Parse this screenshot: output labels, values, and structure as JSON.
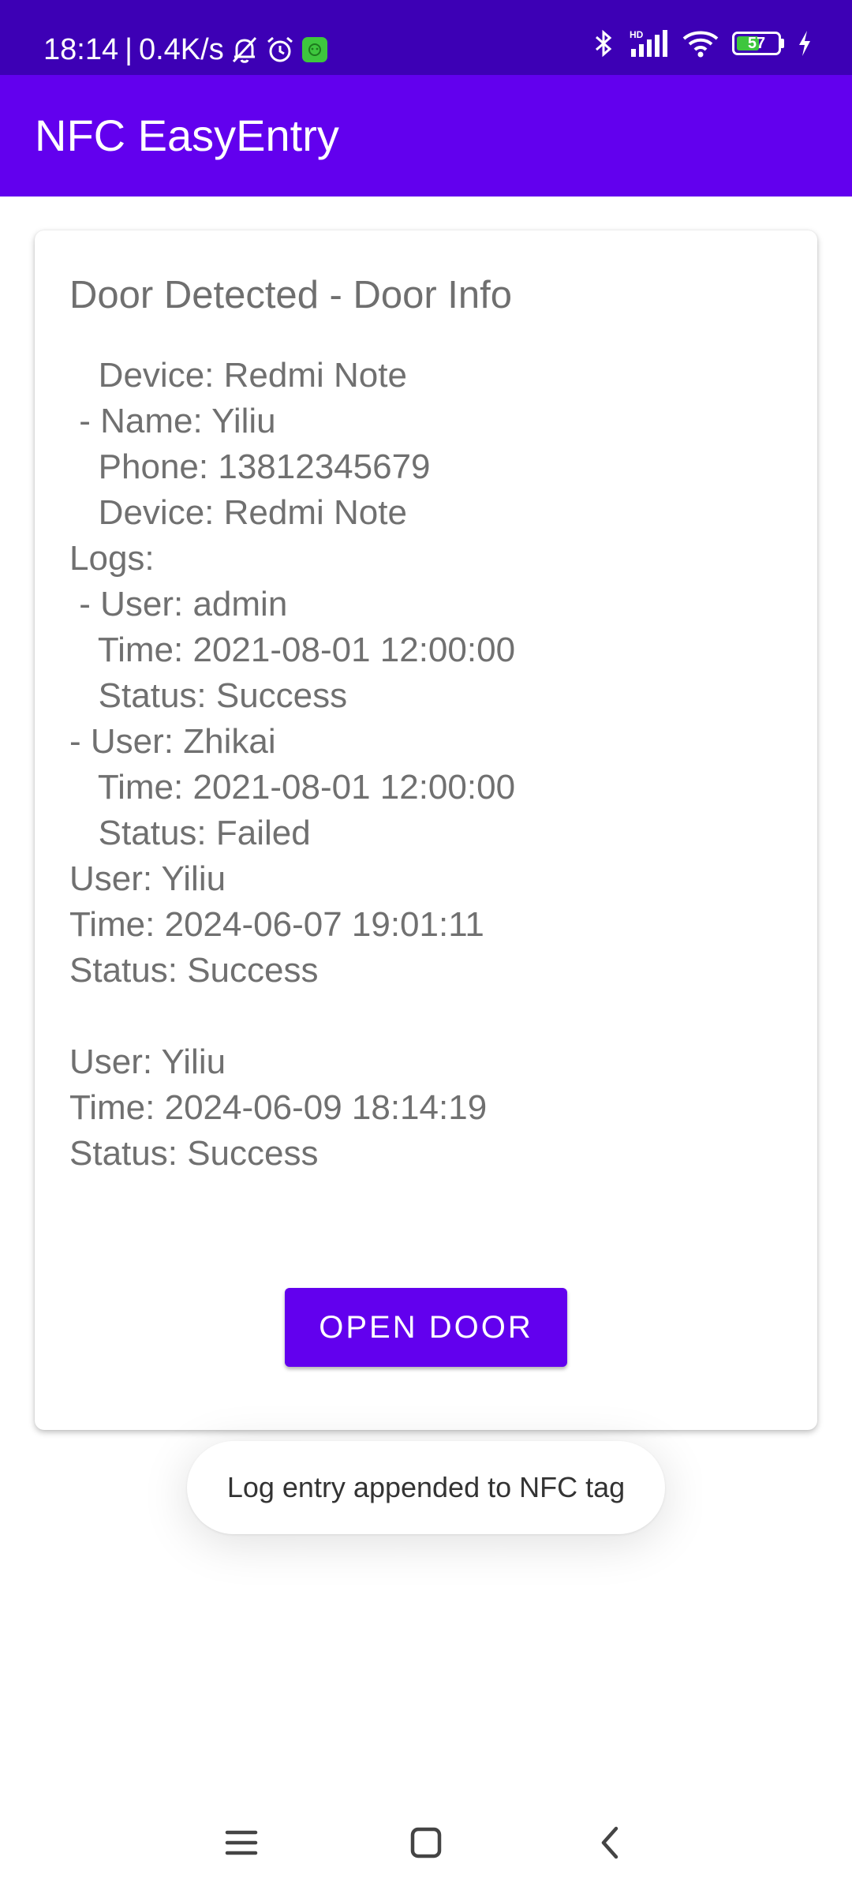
{
  "status_bar": {
    "time": "18:14",
    "separator": "|",
    "net_speed": "0.4K/s",
    "battery_level": "57",
    "battery_fraction": 0.57,
    "icons_left": [
      "bell-off-icon",
      "alarm-icon",
      "android-app-icon"
    ],
    "icons_right": [
      "bluetooth-icon",
      "hd-signal-icon",
      "wifi-icon",
      "battery-icon",
      "charging-icon"
    ]
  },
  "app_bar": {
    "title": "NFC EasyEntry",
    "color": "#6200ee"
  },
  "card": {
    "title": "Door Detected - Door Info",
    "lines": [
      "   Device: Redmi Note",
      " - Name: Yiliu",
      "   Phone: 13812345679",
      "   Device: Redmi Note",
      "Logs:",
      " - User: admin",
      "   Time: 2021-08-01 12:00:00",
      "   Status: Success",
      "- User: Zhikai",
      "   Time: 2021-08-01 12:00:00",
      "   Status: Failed",
      "User: Yiliu",
      "Time: 2024-06-07 19:01:11",
      "Status: Success",
      "",
      "User: Yiliu",
      "Time: 2024-06-09 18:14:19",
      "Status: Success"
    ],
    "button_label": "OPEN DOOR"
  },
  "toast": {
    "message": "Log entry appended to NFC tag"
  },
  "nav_bar": {
    "icons": [
      "menu-icon",
      "home-square-icon",
      "back-chevron-icon"
    ]
  },
  "colors": {
    "status_bar": "#3d00b5",
    "accent": "#6200ee",
    "body_text": "#707070"
  }
}
